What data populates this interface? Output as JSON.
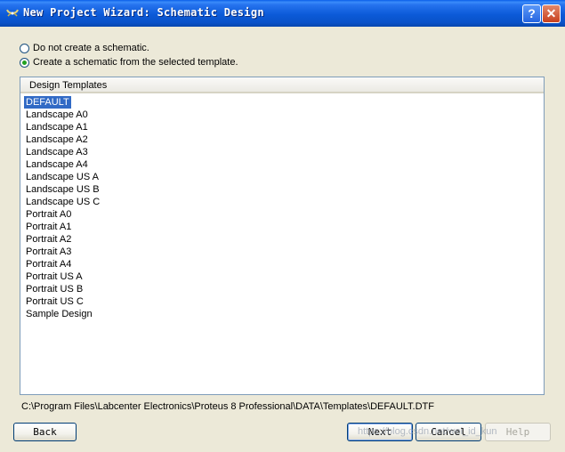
{
  "window": {
    "title": "New Project Wizard: Schematic Design",
    "help_symbol": "?",
    "close_symbol": "✕"
  },
  "options": {
    "no_schematic": "Do not create a schematic.",
    "from_template": "Create a schematic from the selected template.",
    "selected": "from_template"
  },
  "templates": {
    "header": "Design Templates",
    "items": [
      "DEFAULT",
      "Landscape A0",
      "Landscape A1",
      "Landscape A2",
      "Landscape A3",
      "Landscape A4",
      "Landscape US A",
      "Landscape US B",
      "Landscape US C",
      "Portrait A0",
      "Portrait A1",
      "Portrait A2",
      "Portrait A3",
      "Portrait A4",
      "Portrait US A",
      "Portrait US B",
      "Portrait US C",
      "Sample Design"
    ],
    "selected_index": 0
  },
  "path": "C:\\Program Files\\Labcenter Electronics\\Proteus 8 Professional\\DATA\\Templates\\DEFAULT.DTF",
  "buttons": {
    "back": "Back",
    "next": "Next",
    "cancel": "Cancel",
    "help": "Help"
  },
  "watermark": "https://blog.csdn.net/wei_id_kun",
  "colors": {
    "titlebar": "#0A5FE8",
    "selection": "#316AC5",
    "radio_dot": "#21A121",
    "dialog_bg": "#ECE9D8"
  }
}
